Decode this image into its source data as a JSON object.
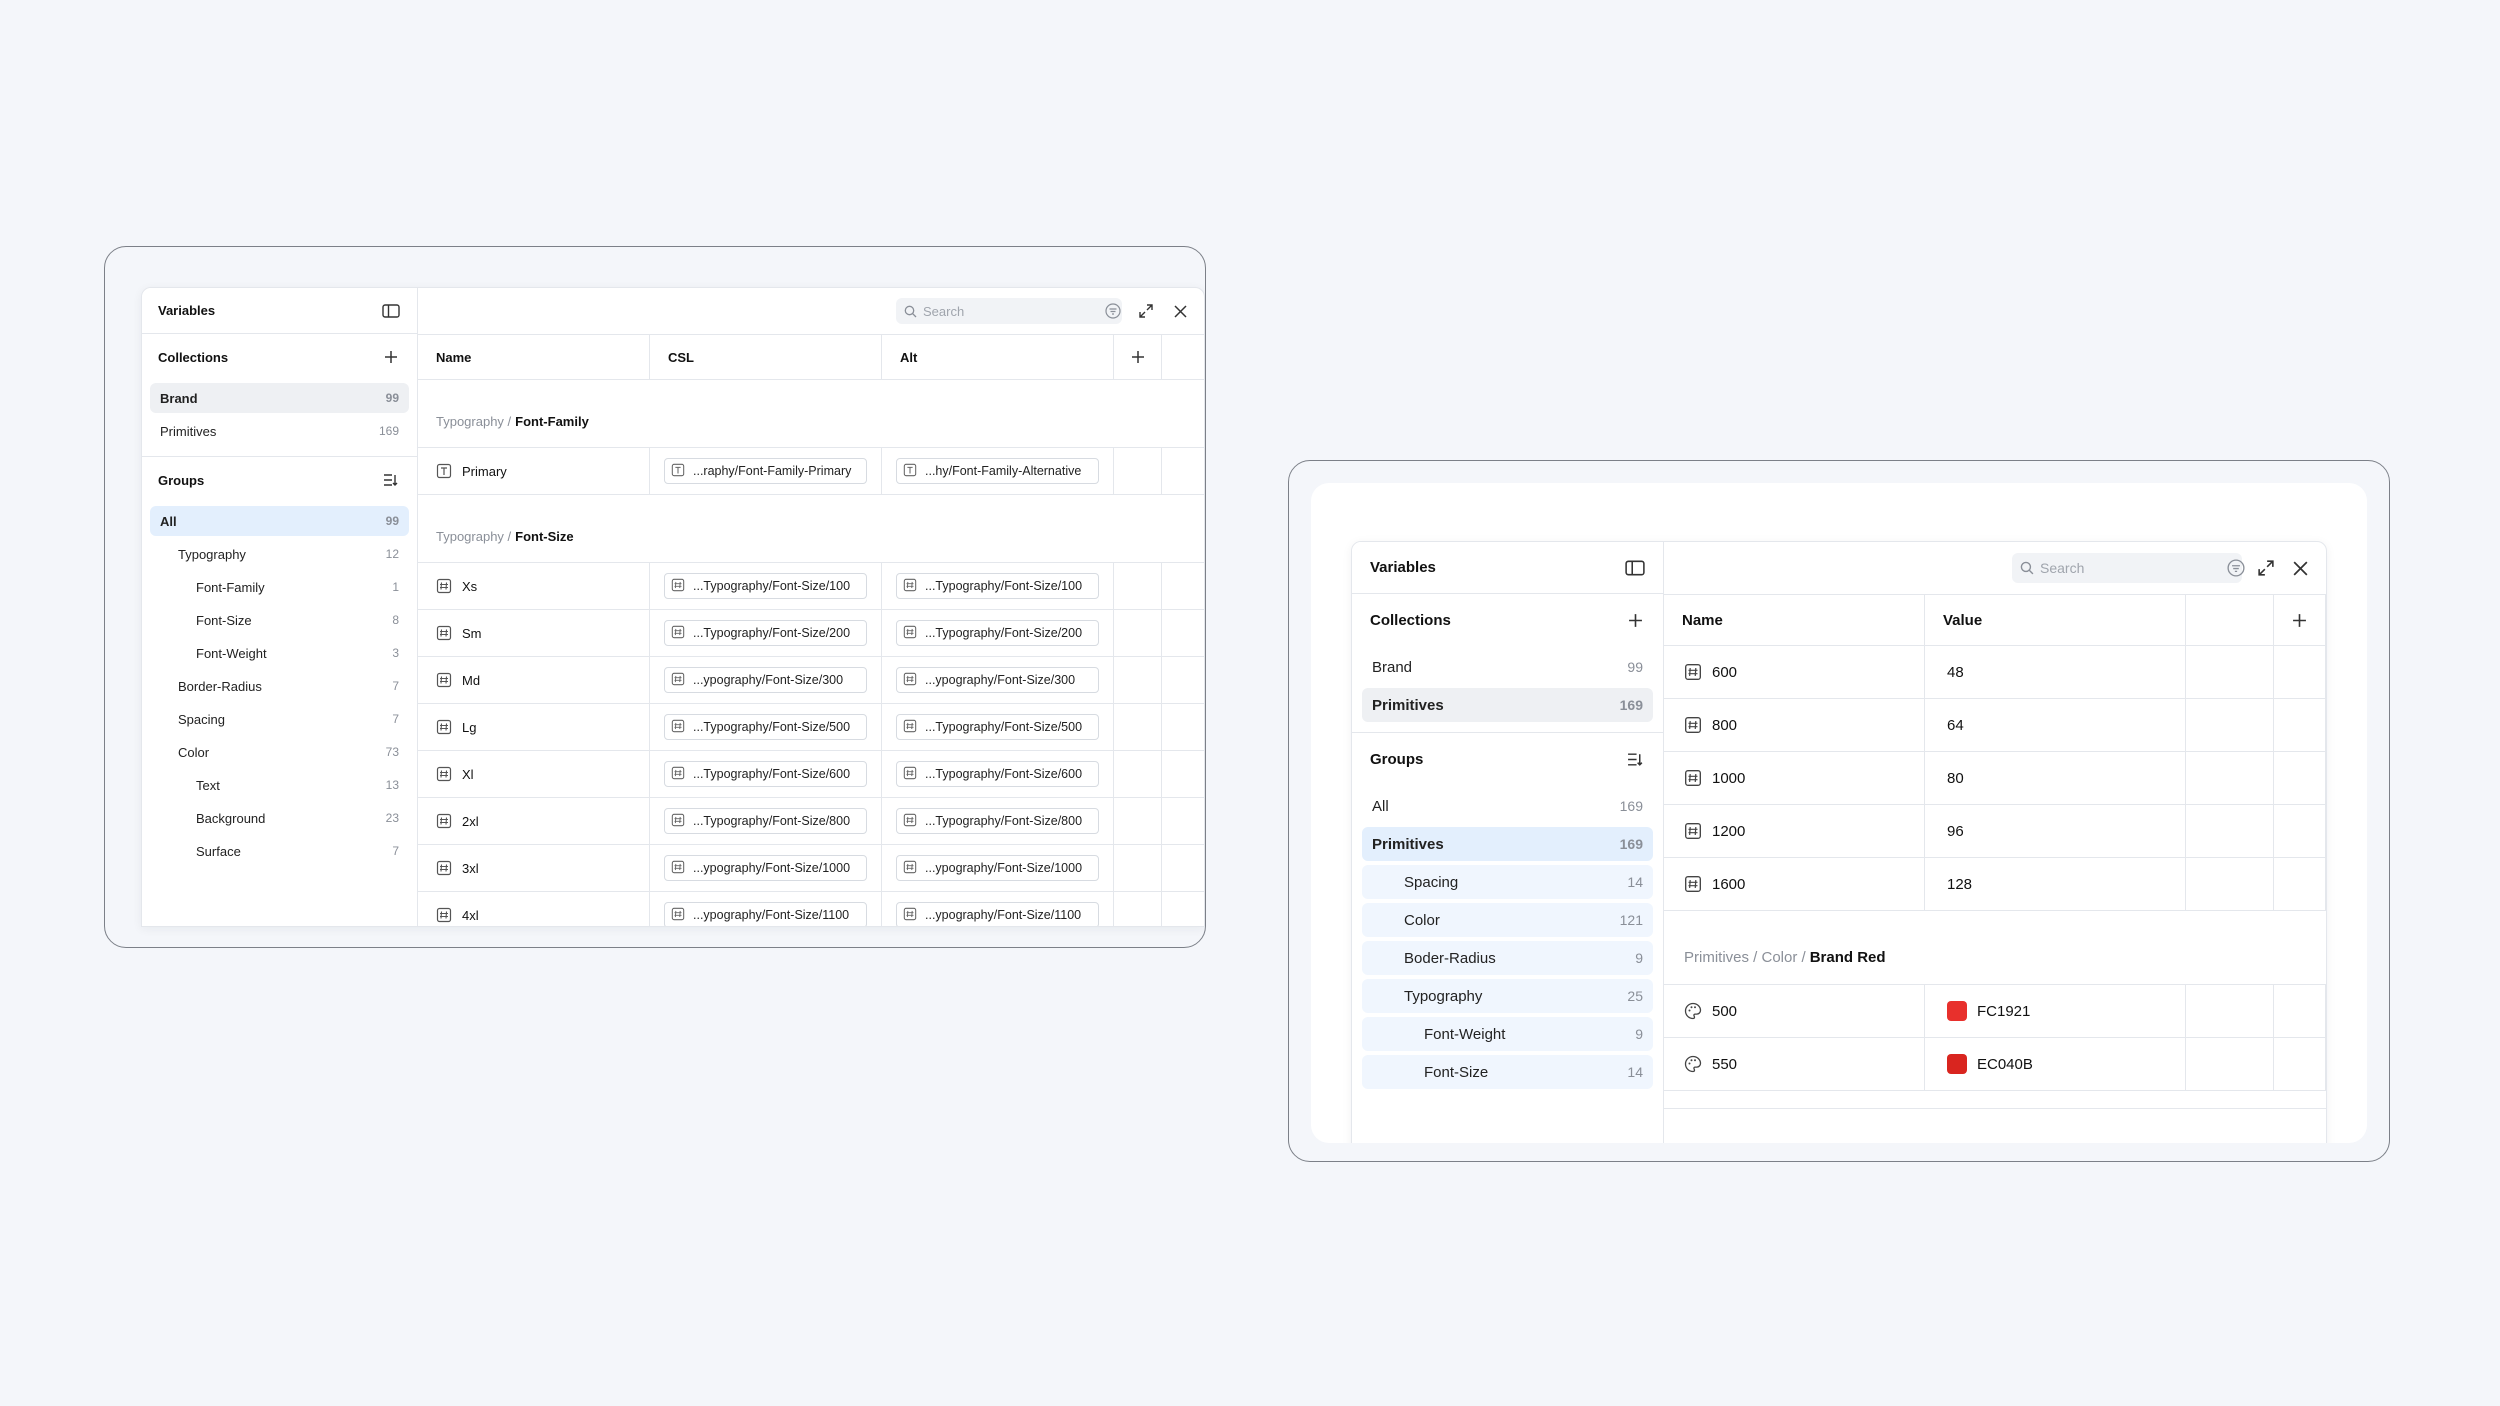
{
  "left": {
    "header": {
      "title": "Variables"
    },
    "collections": {
      "title": "Collections",
      "items": [
        {
          "label": "Brand",
          "count": "99"
        },
        {
          "label": "Primitives",
          "count": "169"
        }
      ]
    },
    "groups": {
      "title": "Groups",
      "items": [
        {
          "label": "All",
          "count": "99"
        },
        {
          "label": "Typography",
          "count": "12"
        },
        {
          "label": "Font-Family",
          "count": "1"
        },
        {
          "label": "Font-Size",
          "count": "8"
        },
        {
          "label": "Font-Weight",
          "count": "3"
        },
        {
          "label": "Border-Radius",
          "count": "7"
        },
        {
          "label": "Spacing",
          "count": "7"
        },
        {
          "label": "Color",
          "count": "73"
        },
        {
          "label": "Text",
          "count": "13"
        },
        {
          "label": "Background",
          "count": "23"
        },
        {
          "label": "Surface",
          "count": "7"
        }
      ]
    },
    "search": {
      "placeholder": "Search"
    },
    "columns": [
      "Name",
      "CSL",
      "Alt"
    ],
    "sections": [
      {
        "path": "Typography /",
        "name": "Font-Family",
        "rows": [
          {
            "name": "Primary",
            "csl": "...raphy/Font-Family-Primary",
            "alt": "...hy/Font-Family-Alternative"
          }
        ]
      },
      {
        "path": "Typography /",
        "name": "Font-Size",
        "rows": [
          {
            "name": "Xs",
            "csl": "...Typography/Font-Size/100",
            "alt": "...Typography/Font-Size/100"
          },
          {
            "name": "Sm",
            "csl": "...Typography/Font-Size/200",
            "alt": "...Typography/Font-Size/200"
          },
          {
            "name": "Md",
            "csl": "...ypography/Font-Size/300",
            "alt": "...ypography/Font-Size/300"
          },
          {
            "name": "Lg",
            "csl": "...Typography/Font-Size/500",
            "alt": "...Typography/Font-Size/500"
          },
          {
            "name": "Xl",
            "csl": "...Typography/Font-Size/600",
            "alt": "...Typography/Font-Size/600"
          },
          {
            "name": "2xl",
            "csl": "...Typography/Font-Size/800",
            "alt": "...Typography/Font-Size/800"
          },
          {
            "name": "3xl",
            "csl": "...ypography/Font-Size/1000",
            "alt": "...ypography/Font-Size/1000"
          },
          {
            "name": "4xl",
            "csl": "...ypography/Font-Size/1100",
            "alt": "...ypography/Font-Size/1100"
          }
        ]
      }
    ]
  },
  "right": {
    "header": {
      "title": "Variables"
    },
    "collections": {
      "title": "Collections",
      "items": [
        {
          "label": "Brand",
          "count": "99"
        },
        {
          "label": "Primitives",
          "count": "169"
        }
      ]
    },
    "groups": {
      "title": "Groups",
      "items": [
        {
          "label": "All",
          "count": "169"
        },
        {
          "label": "Primitives",
          "count": "169"
        },
        {
          "label": "Spacing",
          "count": "14"
        },
        {
          "label": "Color",
          "count": "121"
        },
        {
          "label": "Boder-Radius",
          "count": "9"
        },
        {
          "label": "Typography",
          "count": "25"
        },
        {
          "label": "Font-Weight",
          "count": "9"
        },
        {
          "label": "Font-Size",
          "count": "14"
        }
      ]
    },
    "search": {
      "placeholder": "Search"
    },
    "columns": [
      "Name",
      "Value"
    ],
    "number_rows": [
      {
        "name": "600",
        "value": "48"
      },
      {
        "name": "800",
        "value": "64"
      },
      {
        "name": "1000",
        "value": "80"
      },
      {
        "name": "1200",
        "value": "96"
      },
      {
        "name": "1600",
        "value": "128"
      }
    ],
    "color_section": {
      "path": "Primitives / Color /",
      "name": "Brand Red",
      "rows": [
        {
          "name": "500",
          "value": "FC1921",
          "color": "#e8302c"
        },
        {
          "name": "550",
          "value": "EC040B",
          "color": "#d9251f"
        }
      ]
    }
  }
}
